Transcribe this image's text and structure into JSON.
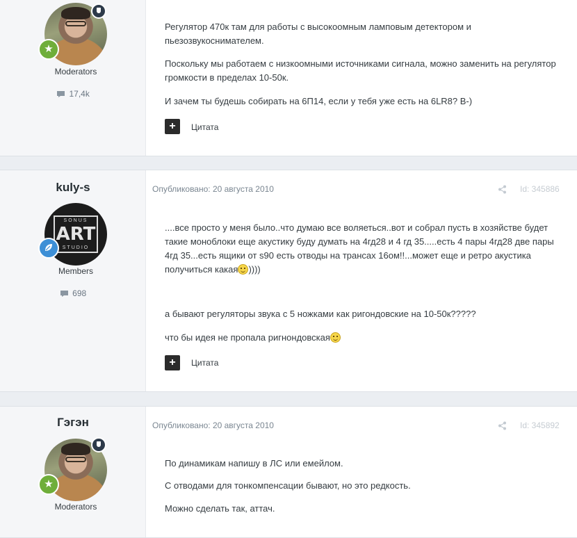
{
  "posts": [
    {
      "author": "",
      "group": "Moderators",
      "post_count": "17,4k",
      "published": "",
      "post_id": "",
      "paragraphs": [
        "Регулятор 470к там для работы с высокоомным ламповым детектором и пьезозвукоснимателем.",
        "Поскольку мы работаем с низкоомными источниками сигнала, можно заменить на регулятор громкости в пределах 10-50к.",
        "И зачем ты будешь собирать на 6П14, если у тебя уже есть на 6LR8? B-)"
      ],
      "quote_label": "Цитата"
    },
    {
      "author": "kuly-s",
      "group": "Members",
      "post_count": "698",
      "published": "Опубликовано: 20 августа 2010",
      "post_id": "Id: 345886",
      "avatar_text_top": "SONUS",
      "avatar_text_big": "ART",
      "avatar_text_bottom": "STUDIO",
      "paragraphs": [
        "....все просто у меня было..что думаю все воляеться..вот и собрал пусть в хозяйстве будет такие моноблоки еще акустику буду думать на 4гд28 и 4 гд 35.....есть 4 пары 4гд28 две пары 4гд 35...есть ящики от s90 есть отводы на трансах 16ом!!...может еще и ретро акустика получиться какая",
        "))))",
        "а бывают регуляторы звука с 5 ножками как ригондовские на 10-50к?????",
        "что бы идея не пропала ригнондовская"
      ],
      "quote_label": "Цитата"
    },
    {
      "author": "Гэгэн",
      "group": "Moderators",
      "post_count": "",
      "published": "Опубликовано: 20 августа 2010",
      "post_id": "Id: 345892",
      "paragraphs": [
        "По динамикам напишу в ЛС или емейлом.",
        "С отводами для тонкомпенсации бывают, но это редкость.",
        "Можно сделать так, аттач."
      ],
      "quote_label": ""
    }
  ],
  "colors": {
    "page_bg": "#ebeef2",
    "author_bg": "#f5f6f8",
    "rank_moderator": "#6fae3a",
    "rank_member": "#3d8fd6",
    "moderator_shield": "#2d3a4a"
  },
  "icons": {
    "post_count": "speech-bubble-icon",
    "share": "share-icon",
    "quote": "plus-icon",
    "rank_moderator": "star-icon",
    "rank_member": "leaf-icon",
    "moderator_badge": "shield-icon",
    "emoticon": "smiley-icon"
  }
}
